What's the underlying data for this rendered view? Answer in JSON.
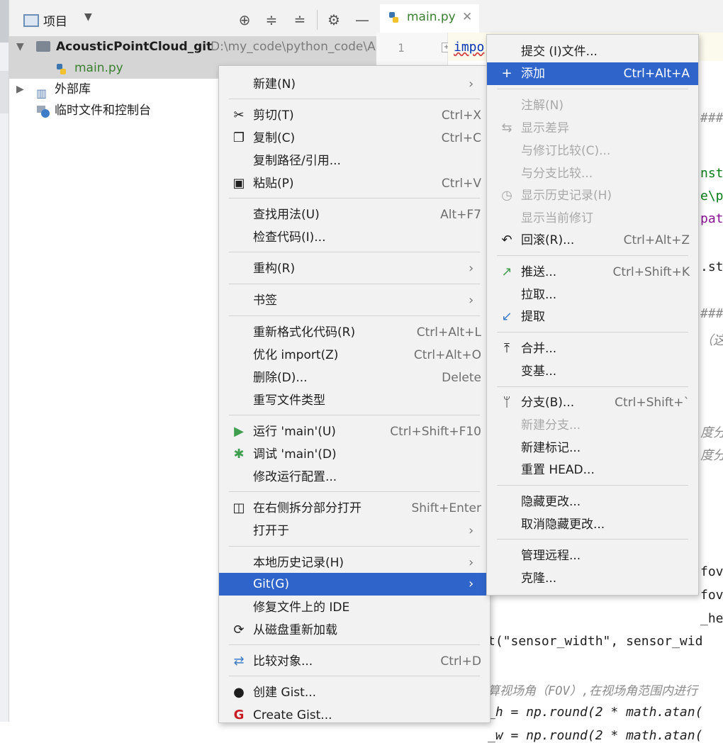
{
  "project_panel": {
    "title": "项目",
    "tree": {
      "root_name": "AcousticPointCloud_git",
      "root_path": "D:\\my_code\\python_code\\A",
      "file": "main.py",
      "external_libs": "外部库",
      "scratches": "临时文件和控制台"
    }
  },
  "editor": {
    "tab_label": "main.py",
    "line_number": "1",
    "first_line": "impo",
    "fragments": {
      "hash1": "###",
      "nst": "nst",
      "ep": "e\\p",
      "pat": "pat",
      "st": ".st",
      "hash2": "###",
      "zhe": "（这",
      "du1": "度分",
      "du2": "度分",
      "fov": "fov",
      "fov2": "fov_",
      "he": "_he",
      "sensor_line": "t(\"sensor_width\", sensor_wid",
      "comment_fov": "算视场角（FOV）,在视场角范围内进行",
      "fov_h": "_h = np.round(2 * math.atan(",
      "fov_w": "_w = np.round(2 * math.atan("
    }
  },
  "context_menu": {
    "items": [
      {
        "label": "新建(N)",
        "sub": true
      },
      {
        "label": "剪切(T)",
        "shortcut": "Ctrl+X",
        "icon": "cut-icon"
      },
      {
        "label": "复制(C)",
        "shortcut": "Ctrl+C",
        "icon": "copy-icon"
      },
      {
        "label": "复制路径/引用..."
      },
      {
        "label": "粘贴(P)",
        "shortcut": "Ctrl+V",
        "icon": "paste-icon"
      },
      {
        "label": "查找用法(U)",
        "shortcut": "Alt+F7"
      },
      {
        "label": "检查代码(I)..."
      },
      {
        "label": "重构(R)",
        "sub": true
      },
      {
        "label": "书签",
        "sub": true
      },
      {
        "label": "重新格式化代码(R)",
        "shortcut": "Ctrl+Alt+L"
      },
      {
        "label": "优化 import(Z)",
        "shortcut": "Ctrl+Alt+O"
      },
      {
        "label": "删除(D)...",
        "shortcut": "Delete"
      },
      {
        "label": "重写文件类型"
      },
      {
        "label": "运行 'main'(U)",
        "shortcut": "Ctrl+Shift+F10",
        "icon": "run-icon"
      },
      {
        "label": "调试 'main'(D)",
        "icon": "debug-icon"
      },
      {
        "label": "修改运行配置..."
      },
      {
        "label": "在右侧拆分部分打开",
        "shortcut": "Shift+Enter",
        "icon": "split-icon"
      },
      {
        "label": "打开于",
        "sub": true
      },
      {
        "label": "本地历史记录(H)",
        "sub": true
      },
      {
        "label": "Git(G)",
        "sub": true,
        "selected": true
      },
      {
        "label": "修复文件上的 IDE"
      },
      {
        "label": "从磁盘重新加载",
        "icon": "reload-icon"
      },
      {
        "label": "比较对象...",
        "shortcut": "Ctrl+D",
        "icon": "compare-icon"
      },
      {
        "label": "创建 Gist...",
        "icon": "github-icon"
      },
      {
        "label": "Create Gist...",
        "icon": "gitee-icon"
      }
    ]
  },
  "git_submenu": {
    "items": [
      {
        "label": "提交 (I)文件..."
      },
      {
        "label": "添加",
        "shortcut": "Ctrl+Alt+A",
        "icon": "plus-icon",
        "selected": true
      },
      {
        "label": "注解(N)",
        "disabled": true
      },
      {
        "label": "显示差异",
        "disabled": true,
        "icon": "diff-icon"
      },
      {
        "label": "与修订比较(C)...",
        "disabled": true
      },
      {
        "label": "与分支比较...",
        "disabled": true
      },
      {
        "label": "显示历史记录(H)",
        "disabled": true,
        "icon": "history-icon"
      },
      {
        "label": "显示当前修订",
        "disabled": true
      },
      {
        "label": "回滚(R)...",
        "shortcut": "Ctrl+Alt+Z",
        "icon": "rollback-icon"
      },
      {
        "label": "推送...",
        "shortcut": "Ctrl+Shift+K",
        "icon": "push-icon"
      },
      {
        "label": "拉取..."
      },
      {
        "label": "提取",
        "icon": "fetch-icon"
      },
      {
        "label": "合并...",
        "icon": "merge-icon"
      },
      {
        "label": "变基..."
      },
      {
        "label": "分支(B)...",
        "shortcut": "Ctrl+Shift+`",
        "icon": "branch-icon"
      },
      {
        "label": "新建分支...",
        "disabled": true
      },
      {
        "label": "新建标记..."
      },
      {
        "label": "重置 HEAD..."
      },
      {
        "label": "隐藏更改..."
      },
      {
        "label": "取消隐藏更改..."
      },
      {
        "label": "管理远程..."
      },
      {
        "label": "克隆..."
      }
    ]
  }
}
